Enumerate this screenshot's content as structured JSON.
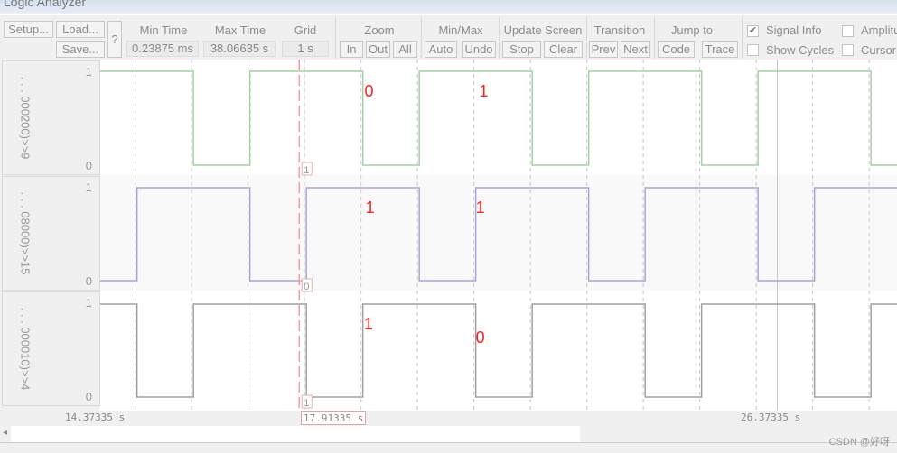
{
  "window": {
    "title": "Logic Analyzer"
  },
  "toolbar": {
    "setup": "Setup...",
    "load": "Load...",
    "save": "Save...",
    "help": "?",
    "min_time_label": "Min Time",
    "min_time": "0.23875 ms",
    "max_time_label": "Max Time",
    "max_time": "38.06635 s",
    "grid_label": "Grid",
    "grid": "1 s",
    "zoom_label": "Zoom",
    "zoom_in": "In",
    "zoom_out": "Out",
    "zoom_all": "All",
    "minmax_label": "Min/Max",
    "auto": "Auto",
    "undo": "Undo",
    "update_label": "Update Screen",
    "stop": "Stop",
    "clear": "Clear",
    "transition_label": "Transition",
    "prev": "Prev",
    "next": "Next",
    "jump_label": "Jump to",
    "code": "Code",
    "trace": "Trace",
    "signal_info": {
      "label": "Signal Info",
      "checked": true
    },
    "show_cycles": {
      "label": "Show Cycles",
      "checked": false
    },
    "amplitude": {
      "label": "Amplitu",
      "checked": false
    },
    "cursor": {
      "label": "Cursor",
      "checked": false
    }
  },
  "signals": [
    {
      "name": ". . . 000200)>>9",
      "high": "1",
      "low": "0",
      "color": "#9fd39f",
      "initial": 1,
      "transitions": [
        16.04,
        17.04,
        19.04,
        20.04,
        22.04,
        23.04,
        25.04,
        26.04,
        28.04
      ],
      "cursor_value": "1"
    },
    {
      "name": ". . . 08000)>>15",
      "high": "1",
      "low": "0",
      "color": "#a8a4dc",
      "initial": 0,
      "transitions": [
        15.04,
        17.04,
        18.04,
        20.04,
        21.04,
        23.04,
        24.04,
        26.04,
        27.04
      ],
      "cursor_value": "0"
    },
    {
      "name": ". . . 000010)>>4",
      "high": "1",
      "low": "0",
      "color": "#a0a0a0",
      "initial": 1,
      "transitions": [
        15.04,
        16.04,
        18.04,
        19.04,
        21.04,
        22.04,
        24.04,
        25.04,
        27.04,
        28.04
      ],
      "cursor_value": "1"
    }
  ],
  "view": {
    "start": 14.37335,
    "end": 28.5,
    "grid_s": 1
  },
  "axis": {
    "left": "14.37335 s",
    "cursor": "17.91335 s",
    "right": "26.37335 s",
    "right_time": 26.37335
  },
  "cursor_time": 17.91335,
  "annotations": [
    {
      "text": "0",
      "signal": 0,
      "t": 19.15,
      "level": "high"
    },
    {
      "text": "1",
      "signal": 0,
      "t": 21.18,
      "level": "high"
    },
    {
      "text": "1",
      "signal": 1,
      "t": 19.17,
      "level": "high"
    },
    {
      "text": "1",
      "signal": 1,
      "t": 21.12,
      "level": "high"
    },
    {
      "text": "1",
      "signal": 2,
      "t": 19.14,
      "level": "high"
    },
    {
      "text": "0",
      "signal": 2,
      "t": 21.12,
      "level": "low"
    }
  ],
  "annotation_color": "#ff2020",
  "watermark": "CSDN @好呀"
}
